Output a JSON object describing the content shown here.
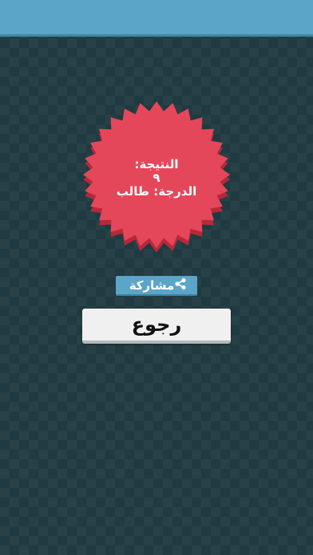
{
  "result": {
    "score_label": "النتيجة:",
    "score_value": "٩",
    "grade_label": "الدرجة: طالب"
  },
  "share": {
    "label": "مشاركة",
    "icon": "share-icon"
  },
  "back": {
    "label": "رجوع"
  },
  "colors": {
    "background": "#1f3a40",
    "top_bar": "#5aa5c8",
    "badge_red": "#e5475a",
    "badge_shadow": "#b8283a",
    "share_button": "#5aa5c8",
    "back_button": "#f0f0f0"
  }
}
